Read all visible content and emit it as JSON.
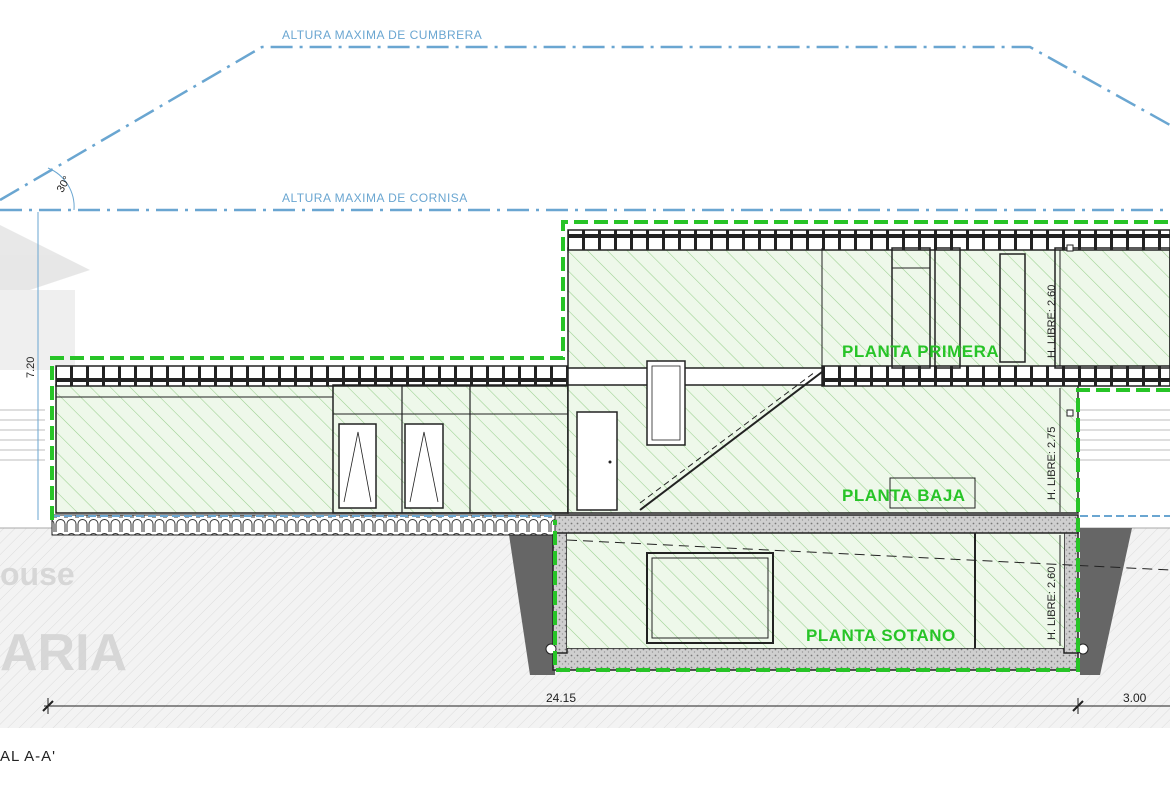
{
  "labels": {
    "altura_cumbrera": "ALTURA MAXIMA DE CUMBRERA",
    "altura_cornisa": "ALTURA MAXIMA DE CORNISA",
    "angle": "30°",
    "height_left": "7.20",
    "floor_primera": "PLANTA PRIMERA",
    "floor_baja": "PLANTA BAJA",
    "floor_sotano": "PLANTA SOTANO",
    "libre_primera": "H. LIBRE: 2.60",
    "libre_baja": "H. LIBRE: 2.75",
    "libre_sotano": "H. LIBRE: 2.60",
    "dim_main": "24.15",
    "dim_right": "3.00",
    "section_title": "AL A-A'"
  },
  "watermark": {
    "line1": "ouse",
    "line2": "ARIA"
  },
  "colors": {
    "limit_line": "#6aa6d1",
    "hatch": "#9bd08f",
    "fill": "#e8f6e3",
    "green_dash": "#27c427",
    "wall": "#222222",
    "ground": "#555555"
  }
}
